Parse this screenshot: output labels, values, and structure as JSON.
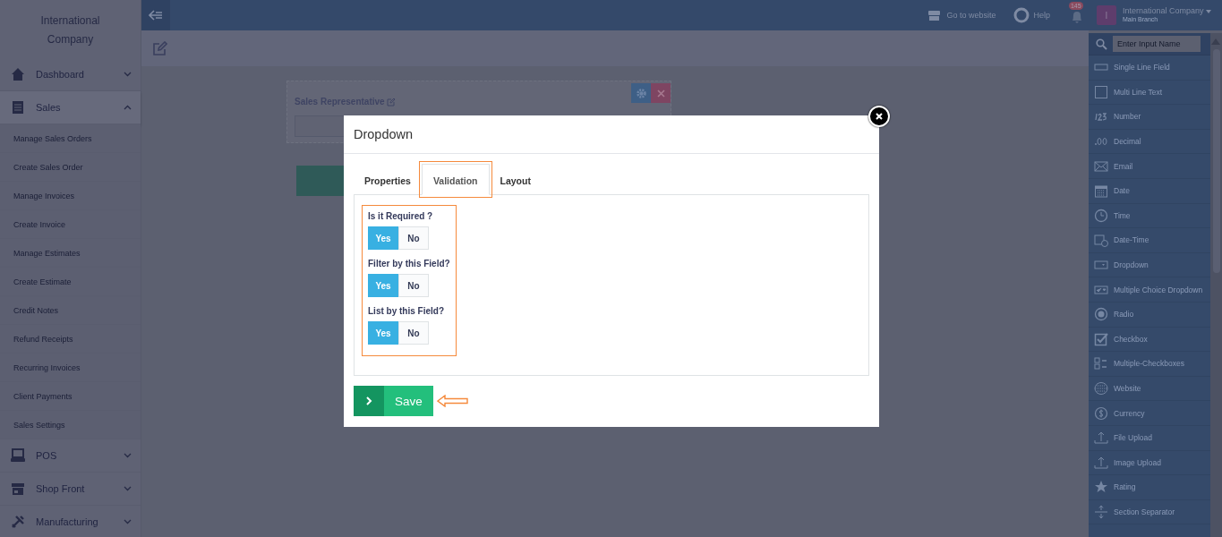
{
  "sidebar": {
    "company": "International Company",
    "items": [
      {
        "label": "Dashboard",
        "expanded": false
      },
      {
        "label": "Sales",
        "expanded": true,
        "children": [
          {
            "label": "Manage Sales Orders"
          },
          {
            "label": "Create Sales Order"
          },
          {
            "label": "Manage Invoices"
          },
          {
            "label": "Create Invoice"
          },
          {
            "label": "Manage Estimates"
          },
          {
            "label": "Create Estimate"
          },
          {
            "label": "Credit Notes"
          },
          {
            "label": "Refund Receipts"
          },
          {
            "label": "Recurring Invoices"
          },
          {
            "label": "Client Payments"
          },
          {
            "label": "Sales Settings"
          }
        ]
      },
      {
        "label": "POS",
        "expanded": false
      },
      {
        "label": "Shop Front",
        "expanded": false
      },
      {
        "label": "Manufacturing",
        "expanded": false
      }
    ]
  },
  "topbar": {
    "go_to_website": "Go to website",
    "help": "Help",
    "notification_count": "145",
    "account": {
      "avatar_letter": "I",
      "name": "International Company",
      "branch": "Main Branch"
    }
  },
  "card": {
    "label": "Sales Representative"
  },
  "modal": {
    "title": "Dropdown",
    "tabs": [
      {
        "label": "Properties",
        "selected": false
      },
      {
        "label": "Validation",
        "selected": true
      },
      {
        "label": "Layout",
        "selected": false
      }
    ],
    "questions": [
      {
        "label": "Is it Required ?",
        "options": [
          {
            "label": "Yes",
            "selected": true
          },
          {
            "label": "No",
            "selected": false
          }
        ]
      },
      {
        "label": "Filter by this Field?",
        "options": [
          {
            "label": "Yes",
            "selected": true
          },
          {
            "label": "No",
            "selected": false
          }
        ]
      },
      {
        "label": "List by this Field?",
        "options": [
          {
            "label": "Yes",
            "selected": true
          },
          {
            "label": "No",
            "selected": false
          }
        ]
      }
    ],
    "save_button": "Save"
  },
  "field_palette": {
    "search_placeholder": "Enter Input Name",
    "items": [
      "Single Line Field",
      "Multi Line Text",
      "Number",
      "Decimal",
      "Email",
      "Date",
      "Time",
      "Date-Time",
      "Dropdown",
      "Multiple Choice Dropdown",
      "Radio",
      "Checkbox",
      "Multiple-Checkboxes",
      "Website",
      "Currency",
      "File Upload",
      "Image Upload",
      "Rating",
      "Section Separator"
    ]
  }
}
